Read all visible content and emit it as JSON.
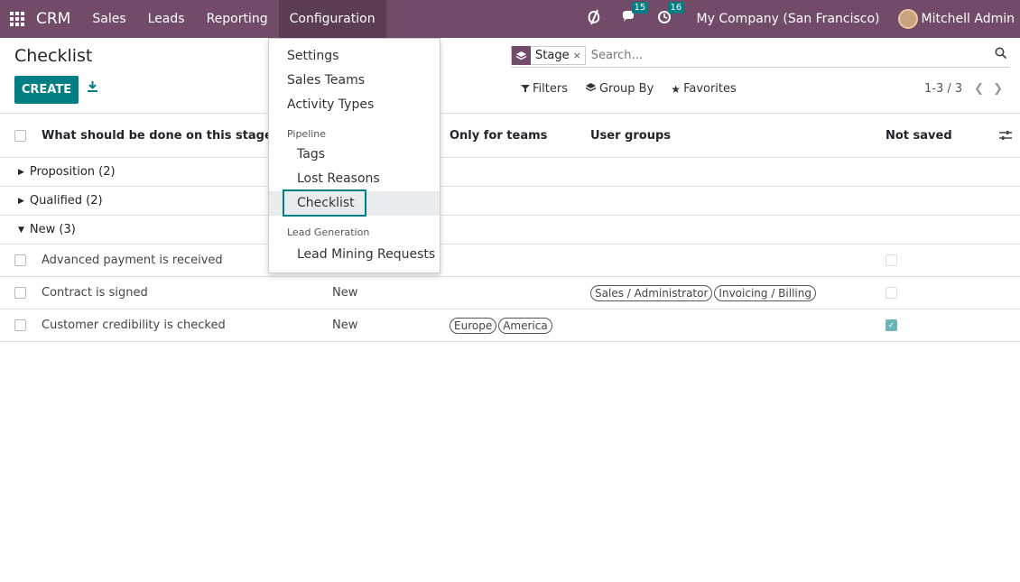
{
  "navbar": {
    "brand": "CRM",
    "menu": [
      "Sales",
      "Leads",
      "Reporting",
      "Configuration"
    ],
    "messages_count": "15",
    "activities_count": "16",
    "company": "My Company (San Francisco)",
    "user": "Mitchell Admin",
    "accent_color": "#714B67"
  },
  "control": {
    "title": "Checklist",
    "create_label": "CREATE",
    "facet_label": "Stage",
    "facet_remove": "×",
    "search_placeholder": "Search...",
    "filters_label": "Filters",
    "groupby_label": "Group By",
    "favorites_label": "Favorites",
    "pager": "1-3 / 3"
  },
  "dropdown": {
    "items": [
      "Settings",
      "Sales Teams",
      "Activity Types"
    ],
    "section_pipeline": "Pipeline",
    "pipeline_items": [
      "Tags",
      "Lost Reasons",
      "Checklist"
    ],
    "section_lead": "Lead Generation",
    "lead_items": [
      "Lead Mining Requests"
    ]
  },
  "table": {
    "headers": {
      "name": "What should be done on this stage",
      "teams": "Only for teams",
      "groups": "User groups",
      "not_saved": "Not saved"
    },
    "groups": [
      {
        "label": "Proposition (2)"
      },
      {
        "label": "Qualified (2)"
      },
      {
        "label": "New (3)"
      }
    ],
    "rows": [
      {
        "name": "Advanced payment is received",
        "stage": "",
        "teams": [],
        "groups": [],
        "checked": false
      },
      {
        "name": "Contract is signed",
        "stage": "New",
        "teams": [],
        "groups": [
          "Sales / Administrator",
          "Invoicing / Billing"
        ],
        "checked": false
      },
      {
        "name": "Customer credibility is checked",
        "stage": "New",
        "teams": [
          "Europe",
          "America"
        ],
        "groups": [],
        "checked": true
      }
    ]
  }
}
